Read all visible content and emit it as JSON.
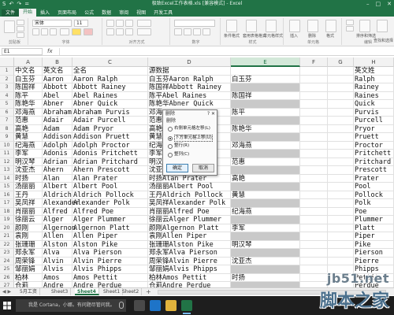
{
  "window": {
    "title": "极致Excel工作表格.xls [兼容模式] - Excel",
    "min": "–",
    "max": "□",
    "close": "✕"
  },
  "qat": [
    "S",
    "↶",
    "↷",
    "="
  ],
  "ribbon_tabs": [
    "文件",
    "开始",
    "插入",
    "页面布局",
    "公式",
    "数据",
    "审阅",
    "视图",
    "开发工具"
  ],
  "ribbon": {
    "font_name": "宋体",
    "font_size": "11",
    "groups": [
      "剪贴板",
      "字体",
      "对齐方式",
      "数字",
      "样式",
      "单元格",
      "编辑"
    ],
    "style_buttons": [
      "条件格式",
      "套用表格格式",
      "单元格样式"
    ],
    "cell_buttons": [
      "插入",
      "删除",
      "格式"
    ],
    "edit_buttons": [
      "排序和筛选",
      "查找和选择"
    ]
  },
  "formula_bar": {
    "name_box": "E1",
    "fx": "fx",
    "formula": ""
  },
  "columns": [
    "A",
    "B",
    "C",
    "D",
    "E",
    "F",
    "G",
    "H"
  ],
  "row_numbers": [
    "1",
    "2",
    "3",
    "4",
    "5",
    "6",
    "7",
    "8",
    "9",
    "10",
    "11",
    "12",
    "13",
    "14",
    "15",
    "16",
    "17",
    "18",
    "19",
    "20",
    "21",
    "22",
    "23",
    "24",
    "25",
    "26",
    "27"
  ],
  "rows": [
    [
      "中文名",
      "英文名",
      "全名",
      "源数据",
      "",
      "",
      "",
      "英文姓"
    ],
    [
      "白玉芬",
      "Aaron",
      "Aaron Ralph",
      "白玉芬Aaron Ralph",
      "白玉芬",
      "",
      "",
      "Ralph"
    ],
    [
      "陈国祥",
      "Abbott",
      "Abbott Rainey",
      "陈国祥Abbott Rainey",
      "",
      "",
      "",
      "Rainey"
    ],
    [
      "陈平",
      "Abel",
      "Abel Raines",
      "陈平Abel Raines",
      "陈国祥",
      "",
      "",
      "Raines"
    ],
    [
      "陈艳华",
      "Abner",
      "Abner Quick",
      "陈艳华Abner Quick",
      "",
      "",
      "",
      "Quick"
    ],
    [
      "邓海燕",
      "Abraham",
      "Abraham Purvis",
      "邓海",
      "陈平",
      "",
      "",
      "Purvis"
    ],
    [
      "范惠",
      "Adair",
      "Adair Purcell",
      "范惠",
      "",
      "",
      "",
      "Purcell"
    ],
    [
      "高艳",
      "Adam",
      "Adam Pryor",
      "高艳",
      "陈艳华",
      "",
      "",
      "Pryor"
    ],
    [
      "黄慧",
      "Addison",
      "Addison Pruett",
      "黄慧",
      "",
      "",
      "",
      "Pruett"
    ],
    [
      "纪海燕",
      "Adolph",
      "Adolph Proctor",
      "纪海",
      "邓海燕",
      "",
      "",
      "Proctor"
    ],
    [
      "李军",
      "Adonis",
      "Adonis Pritchett",
      "李军",
      "",
      "",
      "",
      "Pritchett"
    ],
    [
      "明汉琴",
      "Adrian",
      "Adrian Pritchard",
      "明汉",
      "范惠",
      "",
      "",
      "Pritchard"
    ],
    [
      "沈亚杰",
      "Ahern",
      "Ahern Prescott",
      "沈亚",
      "",
      "",
      "",
      "Prescott"
    ],
    [
      "时扬",
      "Alan",
      "Alan Prater",
      "时扬Alan Prater",
      "高艳",
      "",
      "",
      "Prater"
    ],
    [
      "汤丽丽",
      "Albert",
      "Albert Pool",
      "汤丽丽Albert Pool",
      "",
      "",
      "",
      "Pool"
    ],
    [
      "王丹",
      "Aldrich",
      "Aldrich Pollock",
      "王丹Aldrich Pollock",
      "黄慧",
      "",
      "",
      "Pollock"
    ],
    [
      "吴凤祥",
      "Alexander",
      "Alexander Polk",
      "吴凤祥Alexander Polk",
      "",
      "",
      "",
      "Polk"
    ],
    [
      "肖丽丽",
      "Alfred",
      "Alfred Poe",
      "肖丽丽Alfred Poe",
      "纪海燕",
      "",
      "",
      "Poe"
    ],
    [
      "徐丽云",
      "Alger",
      "Alger Plummer",
      "徐丽云Alger Plummer",
      "",
      "",
      "",
      "Plummer"
    ],
    [
      "颜刚",
      "Algernon",
      "Algernon Platt",
      "颜刚Algernon Platt",
      "李军",
      "",
      "",
      "Platt"
    ],
    [
      "袁刚",
      "Allen",
      "Allen Piper",
      "袁刚Allen Piper",
      "",
      "",
      "",
      "Piper"
    ],
    [
      "张珊珊",
      "Alston",
      "Alston Pike",
      "张珊珊Alston Pike",
      "明汉琴",
      "",
      "",
      "Pike"
    ],
    [
      "郑永军",
      "Alva",
      "Alva Pierson",
      "郑永军Alva Pierson",
      "",
      "",
      "",
      "Pierson"
    ],
    [
      "周荣锋",
      "Alvin",
      "Alvin Pierre",
      "周荣锋Alvin Pierre",
      "沈亚杰",
      "",
      "",
      "Pierre"
    ],
    [
      "邹丽娟",
      "Alvis",
      "Alvis Phipps",
      "邹丽娟Alvis Phipps",
      "",
      "",
      "",
      "Phipps"
    ],
    [
      "柏林",
      "Amos",
      "Amos Pettit",
      "柏林Amos Pettit",
      "时扬",
      "",
      "",
      "Pettit"
    ],
    [
      "仓莉",
      "Andre",
      "Andre Perdue",
      "仓莉Andre Perdue",
      "",
      "",
      "",
      "Perdue"
    ]
  ],
  "dialog": {
    "title": "删除",
    "help": "?",
    "close": "✕",
    "group_label": "删除",
    "options": [
      "右侧单元格左移(L)",
      "下方单元格上移(U)",
      "整行(R)",
      "整列(C)"
    ],
    "selected_index": 1,
    "ok": "确定",
    "cancel": "取消"
  },
  "sheet_tabs": [
    "5月工资",
    "Sheet3",
    "Sheet4",
    "Sheet1",
    "Sheet2"
  ],
  "active_sheet": "Sheet4",
  "add_sheet": "+",
  "taskbar": {
    "search_placeholder": "我是 Cortana，小娜。有问题尽管问我。"
  },
  "watermark": {
    "url": "jb51.net",
    "name": "脚本之家"
  },
  "colors": {
    "excel_green": "#217346",
    "gray_fill": "#c9c9c9"
  }
}
